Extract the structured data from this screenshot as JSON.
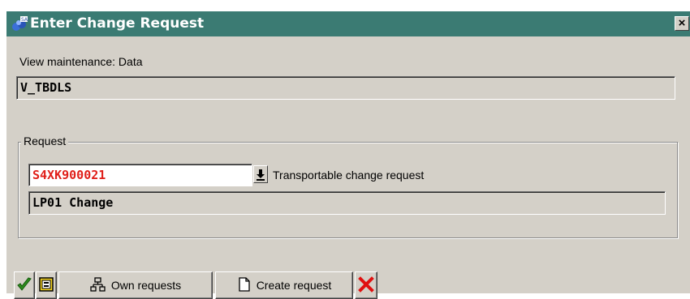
{
  "window": {
    "title": "Enter Change Request",
    "close_glyph": "×"
  },
  "view": {
    "label": "View maintenance: Data",
    "value": "V_TBDLS"
  },
  "request": {
    "group_label": "Request",
    "number": "S4XK900021",
    "type_text": "Transportable change request",
    "description": "LP01 Change"
  },
  "toolbar": {
    "own_requests_label": "Own requests",
    "create_request_label": "Create request"
  },
  "colors": {
    "title_bar": "#3b7b73",
    "dialog_bg": "#d4d0c8",
    "request_number": "#e0201a",
    "confirm": "#2e8b1e",
    "cancel": "#e01010"
  },
  "icons": [
    "sap-window-icon",
    "close-icon",
    "dropdown-arrow-icon",
    "checkmark-icon",
    "choose-icon",
    "hierarchy-icon",
    "new-document-icon",
    "cancel-x-icon"
  ]
}
